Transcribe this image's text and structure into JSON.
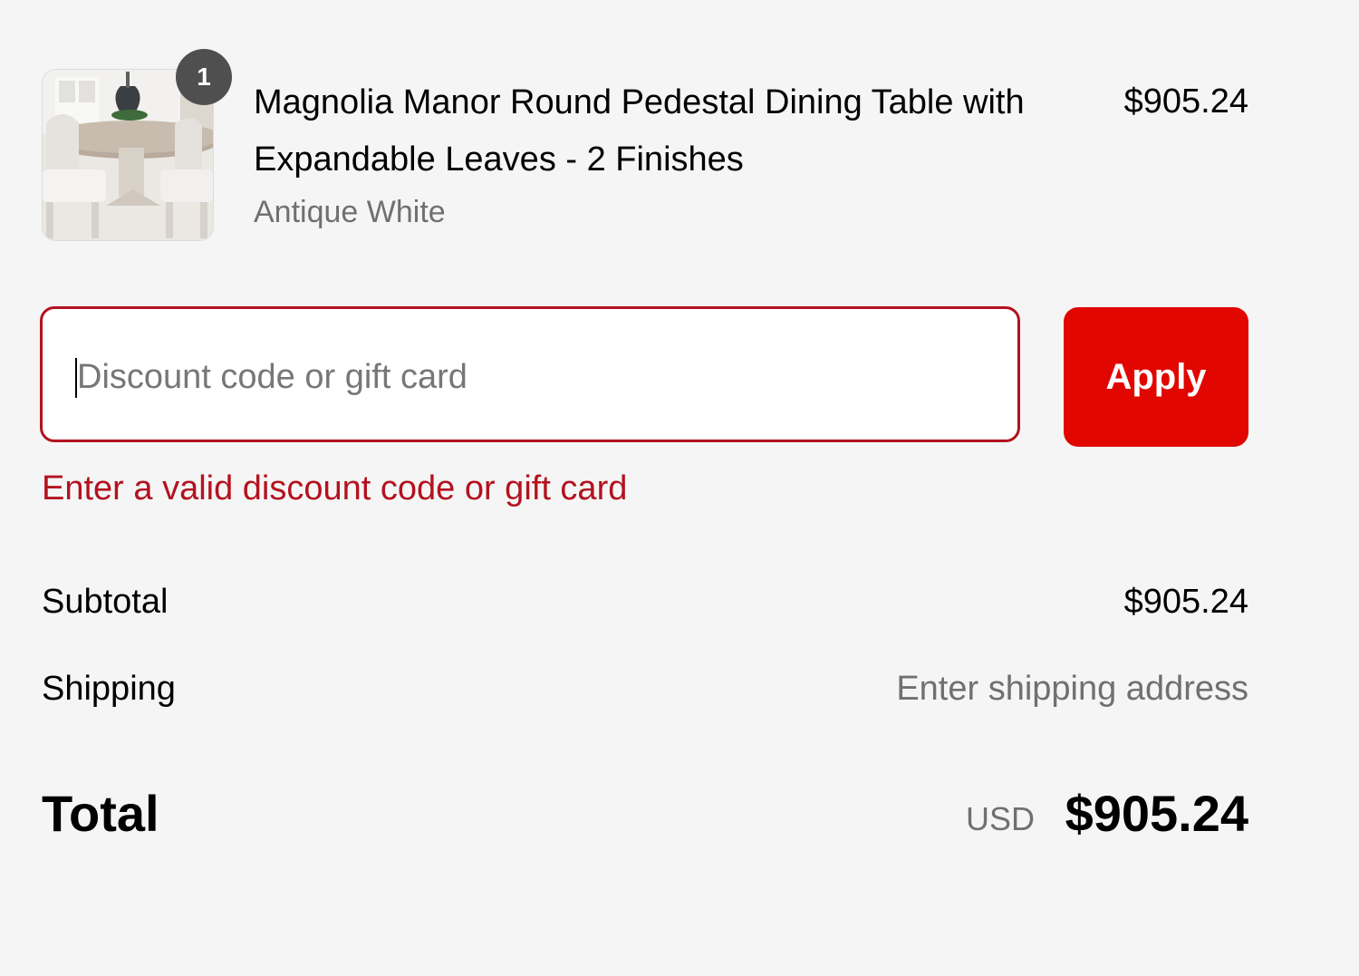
{
  "cart": {
    "items": [
      {
        "quantity": "1",
        "name": "Magnolia Manor Round Pedestal Dining Table with Expandable Leaves - 2 Finishes",
        "variant": "Antique White",
        "price": "$905.24",
        "thumbnail_icon": "dining-table-photo"
      }
    ]
  },
  "discount": {
    "placeholder": "Discount code or gift card",
    "value": "",
    "apply_label": "Apply",
    "error": "Enter a valid discount code or gift card"
  },
  "summary": {
    "subtotal_label": "Subtotal",
    "subtotal_value": "$905.24",
    "shipping_label": "Shipping",
    "shipping_value": "Enter shipping address",
    "total_label": "Total",
    "currency": "USD",
    "total_value": "$905.24"
  },
  "colors": {
    "background": "#f5f5f5",
    "accent": "#e10600",
    "error": "#b3121f",
    "muted_text": "#707070",
    "badge": "#4f4f4f"
  }
}
